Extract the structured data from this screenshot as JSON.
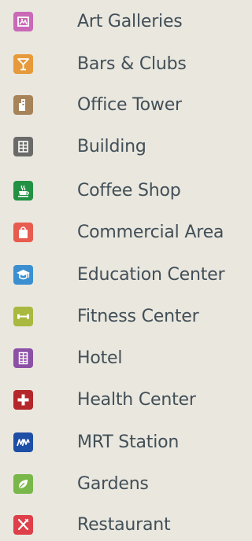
{
  "legend": {
    "items": [
      {
        "label": "Art Galleries",
        "icon": "picture-icon",
        "color": "#c969b7"
      },
      {
        "label": "Bars & Clubs",
        "icon": "cocktail-glass-icon",
        "color": "#e79a3a"
      },
      {
        "label": "Office Tower",
        "icon": "tower-icon",
        "color": "#a7835a"
      },
      {
        "label": "Building",
        "icon": "building-grid-icon",
        "color": "#6a6a68"
      },
      {
        "label": "Coffee Shop",
        "icon": "coffee-cup-icon",
        "color": "#239144"
      },
      {
        "label": "Commercial Area",
        "icon": "shopping-bag-icon",
        "color": "#e75c4f"
      },
      {
        "label": "Education Center",
        "icon": "graduation-cap-icon",
        "color": "#3b8fd0"
      },
      {
        "label": "Fitness Center",
        "icon": "dumbbell-icon",
        "color": "#a9b93f"
      },
      {
        "label": "Hotel",
        "icon": "hotel-icon",
        "color": "#8c51a6"
      },
      {
        "label": "Health Center",
        "icon": "medical-cross-icon",
        "color": "#b5262a"
      },
      {
        "label": "MRT Station",
        "icon": "mrt-logo-icon",
        "color": "#1e4fa6"
      },
      {
        "label": "Gardens",
        "icon": "leaf-icon",
        "color": "#79b74a"
      },
      {
        "label": "Restaurant",
        "icon": "fork-knife-icon",
        "color": "#de3f48"
      }
    ]
  }
}
